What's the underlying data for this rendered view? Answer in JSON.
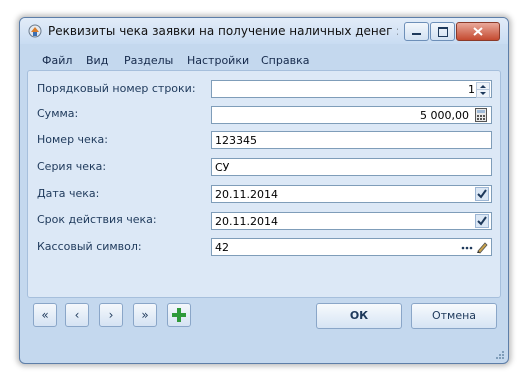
{
  "window": {
    "title": "Реквизиты чека заявки на получение наличных денег :: Доба..."
  },
  "menu": [
    "Файл",
    "Вид",
    "Разделы",
    "Настройки",
    "Справка"
  ],
  "form": {
    "row_number": {
      "label": "Порядковый номер строки:",
      "value": "1"
    },
    "amount": {
      "label": "Сумма:",
      "value": "5 000,00"
    },
    "check_number": {
      "label": "Номер чека:",
      "value": "123345"
    },
    "check_series": {
      "label": "Серия чека:",
      "value": "СУ"
    },
    "check_date": {
      "label": "Дата чека:",
      "value": "20.11.2014"
    },
    "valid_until": {
      "label": "Срок действия чека:",
      "value": "20.11.2014"
    },
    "cash_symbol": {
      "label": "Кассовый символ:",
      "value": "42"
    }
  },
  "buttons": {
    "first": "«",
    "prev": "‹",
    "next": "›",
    "last": "»",
    "ok": "ОК",
    "cancel": "Отмена"
  },
  "icons": {
    "app": "app-icon",
    "calculator": "calculator-icon",
    "checkbox": "checkmark-icon",
    "ellipsis": "ellipsis-icon",
    "edit": "pencil-icon",
    "add": "plus-icon"
  }
}
